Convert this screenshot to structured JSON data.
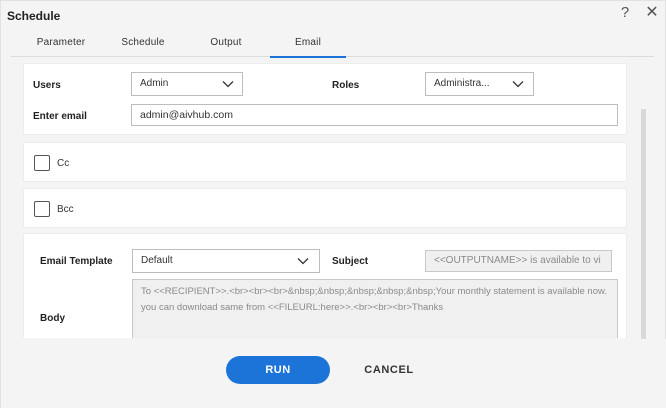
{
  "dialog": {
    "title": "Schedule",
    "help_glyph": "?",
    "close_glyph": "✕"
  },
  "tabs": [
    {
      "label": "Parameter",
      "active": false
    },
    {
      "label": "Schedule",
      "active": false
    },
    {
      "label": "Output",
      "active": false
    },
    {
      "label": "Email",
      "active": true
    }
  ],
  "recipients": {
    "users_label": "Users",
    "users_value": "Admin",
    "roles_label": "Roles",
    "roles_value": "Administra...",
    "email_label": "Enter email",
    "email_value": "admin@aivhub.com"
  },
  "cc": {
    "label": "Cc",
    "checked": false
  },
  "bcc": {
    "label": "Bcc",
    "checked": false
  },
  "template": {
    "template_label": "Email Template",
    "template_value": "Default",
    "subject_label": "Subject",
    "subject_value": "<<OUTPUTNAME>> is available to vi",
    "body_label": "Body",
    "body_value": "To <<RECIPIENT>>.<br><br><br>&nbsp;&nbsp;&nbsp;&nbsp;&nbsp;Your monthly statement is available now. you can download same from <<FILEURL:here>>.<br><br><br>Thanks"
  },
  "footer": {
    "run_label": "RUN",
    "cancel_label": "CANCEL"
  },
  "colors": {
    "accent": "#1d74d8"
  }
}
